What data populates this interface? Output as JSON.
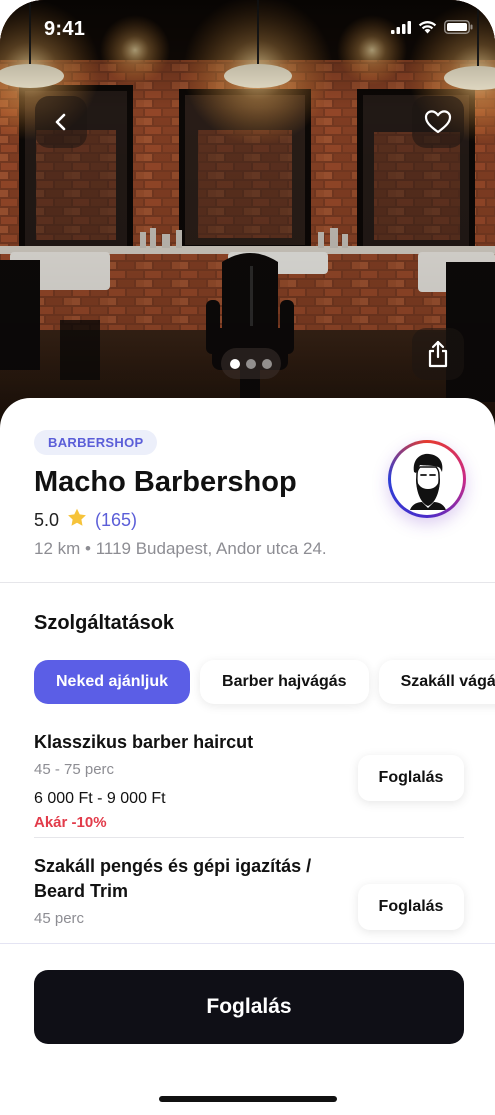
{
  "status_bar": {
    "time": "9:41"
  },
  "hero": {
    "photo": "barbershop-interior",
    "pager": {
      "count": 3,
      "active": 0
    }
  },
  "shop": {
    "category": "BARBERSHOP",
    "name": "Macho Barbershop",
    "rating": "5.0",
    "review_count": "(165)",
    "address": "12 km • 1119 Budapest, Andor utca 24.",
    "logo": "bearded-man-logo"
  },
  "services": {
    "title": "Szolgáltatások",
    "chips": [
      {
        "label": "Neked ajánljuk",
        "active": true
      },
      {
        "label": "Barber hajvágás",
        "active": false
      },
      {
        "label": "Szakáll vágás",
        "active": false
      }
    ],
    "items": [
      {
        "name": "Klasszikus barber haircut",
        "duration": "45 - 75 perc",
        "price": "6 000 Ft - 9 000 Ft",
        "discount": "Akár -10%",
        "button": "Foglalás"
      },
      {
        "name": "Szakáll pengés és gépi igazítás / Beard Trim",
        "duration": "45 perc",
        "button": "Foglalás"
      }
    ]
  },
  "cta": {
    "label": "Foglalás"
  },
  "colors": {
    "accent": "#5b5ee6",
    "discount": "#e23b4a",
    "cta": "#0f0f16"
  }
}
